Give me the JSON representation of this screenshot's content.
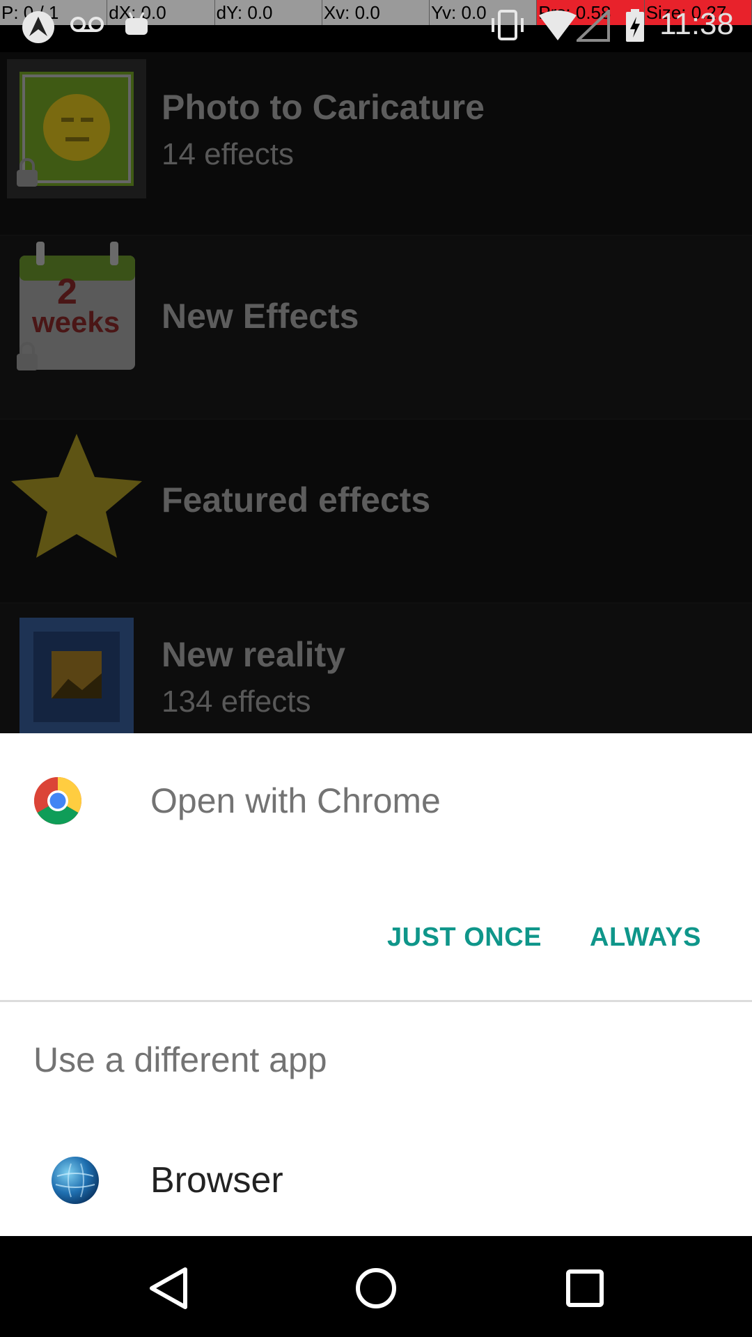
{
  "debug_bar": {
    "cells": [
      "P: 0 / 1",
      "dX: 0.0",
      "dY: 0.0",
      "Xv: 0.0",
      "Yv: 0.0",
      "Prs: 0.58",
      "Size: 0.27"
    ],
    "highlight_color": "#e8222b"
  },
  "status_bar": {
    "time": "11:38",
    "icons": [
      "app-notification-icon",
      "voicemail-icon",
      "android-icon",
      "vibrate-icon",
      "wifi-icon",
      "signal-icon",
      "battery-charging-icon"
    ]
  },
  "background_list": {
    "items": [
      {
        "title": "Photo to Caricature",
        "subtitle": "14 effects",
        "icon": "caricature-thumbnail",
        "locked": true
      },
      {
        "title": "New Effects",
        "subtitle": "",
        "icon": "calendar-2-weeks-icon",
        "locked": true,
        "calendar_number": "2",
        "calendar_word": "weeks"
      },
      {
        "title": "Featured effects",
        "subtitle": "",
        "icon": "star-icon",
        "locked": false
      },
      {
        "title": "New reality",
        "subtitle": "134 effects",
        "icon": "picture-frame-icon",
        "locked": false
      }
    ]
  },
  "dialog": {
    "title": "Open with Chrome",
    "app_icon": "chrome-icon",
    "just_once_label": "JUST ONCE",
    "always_label": "ALWAYS",
    "accent_color": "#0f968a",
    "different_app_label": "Use a different app",
    "alternatives": [
      {
        "label": "Browser",
        "icon": "browser-globe-icon"
      }
    ]
  },
  "nav_bar": {
    "buttons": [
      "back-icon",
      "home-icon",
      "recents-icon"
    ]
  }
}
